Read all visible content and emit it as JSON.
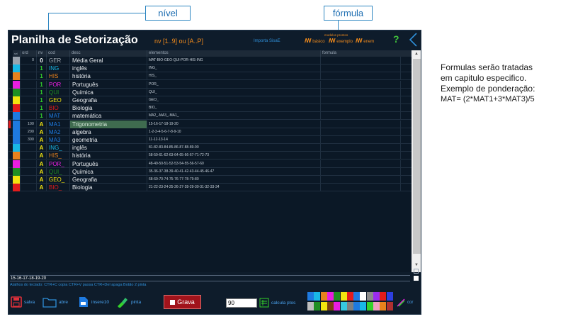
{
  "callouts": {
    "nivel": "nível",
    "formula": "fórmula"
  },
  "app": {
    "title": "Planilha de Setorização",
    "nv_hint": "nv  [1..9] ou [A..P]",
    "importa": "Importa SisaE",
    "modelos_label": "modelos prontos",
    "models": [
      "básico",
      "exemplo",
      "enem"
    ],
    "help": "?"
  },
  "grid": {
    "headers": [
      "sel",
      "ord",
      "nv",
      "cod",
      "desc",
      "elementos",
      "formula"
    ],
    "rows": [
      {
        "color": "#9aa3ad",
        "ord": "0",
        "nv": "0",
        "nv_color": "#ffffff",
        "cod": "GER",
        "cod_color": "#a4acb4",
        "desc": "Média Geral",
        "elem": "MAT-BIO-GEO-QUI-POR-HIS-ING",
        "marker": false,
        "selected": false
      },
      {
        "color": "#19b8e6",
        "ord": "",
        "nv": "1",
        "nv_color": "#33d12a",
        "cod": "ING",
        "cod_color": "#19b8e6",
        "desc": "inglês",
        "elem": "ING_",
        "marker": false,
        "selected": false
      },
      {
        "color": "#e8821c",
        "ord": "",
        "nv": "1",
        "nv_color": "#33d12a",
        "cod": "HIS",
        "cod_color": "#e8821c",
        "desc": "história",
        "elem": "HIS_",
        "marker": false,
        "selected": false
      },
      {
        "color": "#e91ee0",
        "ord": "",
        "nv": "1",
        "nv_color": "#33d12a",
        "cod": "POR",
        "cod_color": "#e91ee0",
        "desc": "Português",
        "elem": "POR_",
        "marker": false,
        "selected": false
      },
      {
        "color": "#1f8f23",
        "ord": "",
        "nv": "1",
        "nv_color": "#33d12a",
        "cod": "QUI",
        "cod_color": "#1f8f23",
        "desc": "Química",
        "elem": "QUI_",
        "marker": false,
        "selected": false
      },
      {
        "color": "#f2e40f",
        "ord": "",
        "nv": "1",
        "nv_color": "#33d12a",
        "cod": "GEO",
        "cod_color": "#f2e40f",
        "desc": "Geografia",
        "elem": "GEO_",
        "marker": false,
        "selected": false
      },
      {
        "color": "#e31c1c",
        "ord": "",
        "nv": "1",
        "nv_color": "#33d12a",
        "cod": "BIO",
        "cod_color": "#e31c1c",
        "desc": "Biologia",
        "elem": "BIO_",
        "marker": false,
        "selected": false
      },
      {
        "color": "#1e7ae0",
        "ord": "",
        "nv": "1",
        "nv_color": "#33d12a",
        "cod": "MAT",
        "cod_color": "#1e7ae0",
        "desc": "matemática",
        "elem": "MA2_-MA3_-MA1_",
        "marker": false,
        "selected": false
      },
      {
        "color": "#1e7ae0",
        "ord": "100",
        "nv": "A",
        "nv_color": "#f2e40f",
        "cod": "MA1",
        "cod_color": "#1e7ae0",
        "desc": "Trigonometria",
        "elem": "15-16-17-18-19-20",
        "marker": true,
        "selected": true
      },
      {
        "color": "#1e7ae0",
        "ord": "200",
        "nv": "A",
        "nv_color": "#f2e40f",
        "cod": "MA2",
        "cod_color": "#1e7ae0",
        "desc": "algebra",
        "elem": "1-2-3-4-5-6-7-8-9-10",
        "marker": false,
        "selected": false
      },
      {
        "color": "#1e7ae0",
        "ord": "300",
        "nv": "A",
        "nv_color": "#f2e40f",
        "cod": "MA3",
        "cod_color": "#1e7ae0",
        "desc": "geometria",
        "elem": "11-12-13-14",
        "marker": false,
        "selected": false
      },
      {
        "color": "#19b8e6",
        "ord": "",
        "nv": "A",
        "nv_color": "#f2e40f",
        "cod": "ING_",
        "cod_color": "#19b8e6",
        "desc": "inglês",
        "elem": "81-82-83-84-85-86-87-88-89-90",
        "marker": false,
        "selected": false
      },
      {
        "color": "#e8821c",
        "ord": "",
        "nv": "A",
        "nv_color": "#f2e40f",
        "cod": "HIS_",
        "cod_color": "#e8821c",
        "desc": "história",
        "elem": "58-59-61-62-63-64-65-66-67-71-72-73",
        "marker": false,
        "selected": false
      },
      {
        "color": "#e91ee0",
        "ord": "",
        "nv": "A",
        "nv_color": "#f2e40f",
        "cod": "POR_",
        "cod_color": "#e91ee0",
        "desc": "Português",
        "elem": "48-49-50-51-52-53-54-55-56-57-60",
        "marker": false,
        "selected": false
      },
      {
        "color": "#1f8f23",
        "ord": "",
        "nv": "A",
        "nv_color": "#f2e40f",
        "cod": "QUI_",
        "cod_color": "#1f8f23",
        "desc": "Química",
        "elem": "35-36-37-38-39-40-41-42-43-44-45-46-47",
        "marker": false,
        "selected": false
      },
      {
        "color": "#f2e40f",
        "ord": "",
        "nv": "A",
        "nv_color": "#f2e40f",
        "cod": "GEO_",
        "cod_color": "#f2e40f",
        "desc": "Geografia",
        "elem": "68-69-70-74-75-76-77-78-79-80",
        "marker": false,
        "selected": false
      },
      {
        "color": "#e31c1c",
        "ord": "",
        "nv": "A",
        "nv_color": "#f2e40f",
        "cod": "BIO_",
        "cod_color": "#e31c1c",
        "desc": "Biologia",
        "elem": "21-22-23-24-25-26-27-28-29-30-31-32-33-34",
        "marker": false,
        "selected": false
      }
    ]
  },
  "editor": {
    "value": "15-16-17-18-19-20"
  },
  "shortcuts": "Atalhos do teclado:  CTR+C copia     CTR+V passa   CTR+Del apaga    Botão 2 pinta",
  "toolbar": {
    "salva": "salva",
    "abre": "abre",
    "insere10": "insere10",
    "pinta": "pinta",
    "grava": "Grava",
    "pts_value": "90",
    "calcula": "calcula ptos",
    "cor": "cor"
  },
  "palette": [
    "#1e7ae0",
    "#19b8e6",
    "#e8821c",
    "#e91ee0",
    "#1f8f23",
    "#f2e40f",
    "#e31c1c",
    "#1e7ae0",
    "#ffffff",
    "#8c8c8c",
    "#9b2df0",
    "#e31c1c",
    "#2d3fe0",
    "#bfbfbf",
    "#1f8f23",
    "#f2e40f",
    "#7a3f10",
    "#e91ee0",
    "#36c9e0",
    "#808080",
    "#1e7ae0",
    "#19b8e6",
    "#33d12a",
    "#f0a0c0",
    "#e8821c",
    "#b03030"
  ],
  "note": {
    "lines": [
      "Formulas serão tratadas",
      "em capitulo especifico.",
      "Exemplo de ponderação:",
      "MAT=    (2*MAT1+3*MAT3)/5"
    ]
  }
}
